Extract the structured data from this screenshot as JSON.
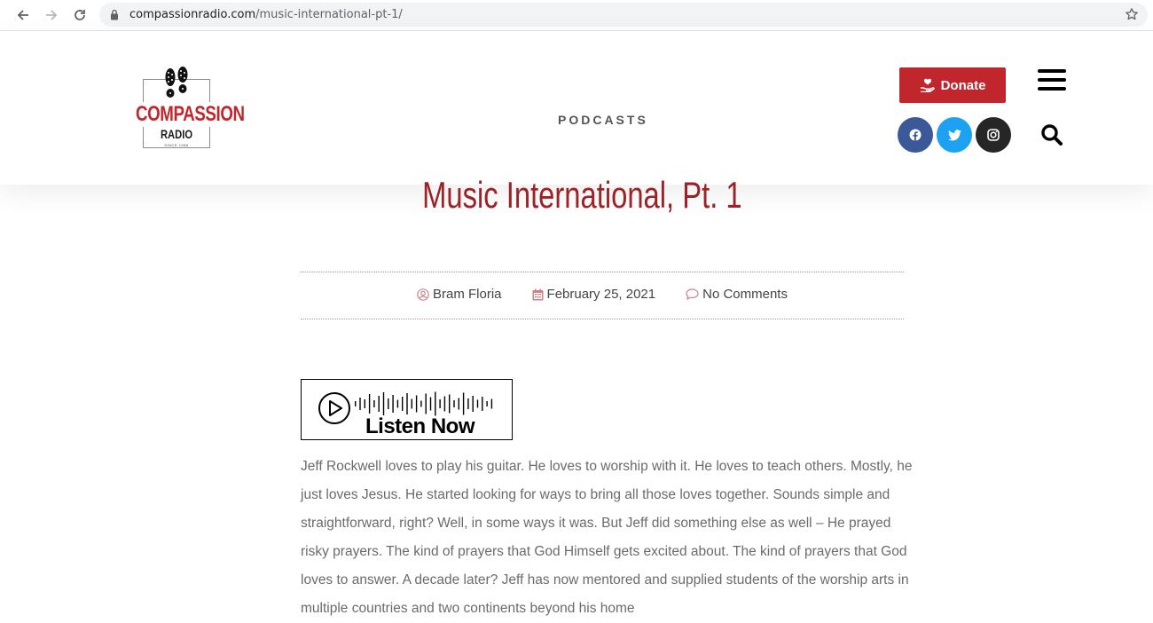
{
  "browser": {
    "url_domain": "compassionradio.com",
    "url_path": "/music-international-pt-1/"
  },
  "header": {
    "logo": {
      "main": "COMPASSION",
      "sub": "RADIO",
      "tiny": "SINCE 1968"
    },
    "nav_podcasts": "PODCASTS",
    "donate_label": "Donate",
    "colors": {
      "brand_red": "#c1262d",
      "facebook": "#3b5998",
      "twitter": "#1da1f2",
      "instagram": "#262626"
    }
  },
  "post": {
    "title": "Music International, Pt. 1",
    "meta": {
      "author": "Bram Floria",
      "date": "February 25, 2021",
      "comments": "No Comments"
    },
    "listen_label": "Listen Now",
    "body": "Jeff Rockwell loves to play his guitar. He loves to worship with it. He loves to teach others. Mostly, he just loves Jesus. He started looking for ways to bring all those loves together. Sounds simple and straightforward, right? Well, in some ways it was. But Jeff did something else as well – He prayed risky prayers. The kind of prayers that God Himself gets excited about. The kind of prayers that God loves to answer. A decade later? Jeff has now mentored and supplied students of the worship arts in multiple countries and two continents beyond his home"
  }
}
